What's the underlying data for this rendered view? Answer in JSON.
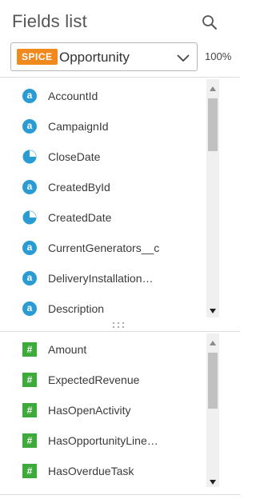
{
  "header": {
    "title": "Fields list",
    "search_icon": "search-icon"
  },
  "dataset": {
    "badge": "SPICE",
    "name": "Opportunity",
    "zoom": "100%"
  },
  "colors": {
    "dimension": "#2b9bd3",
    "measure": "#3eaa3b",
    "spice": "#f0891e"
  },
  "dimensions": [
    {
      "label": "AccountId",
      "icon": "a"
    },
    {
      "label": "CampaignId",
      "icon": "a"
    },
    {
      "label": "CloseDate",
      "icon": "clock"
    },
    {
      "label": "CreatedById",
      "icon": "a"
    },
    {
      "label": "CreatedDate",
      "icon": "clock"
    },
    {
      "label": "CurrentGenerators__c",
      "icon": "a"
    },
    {
      "label": "DeliveryInstallation…",
      "icon": "a"
    },
    {
      "label": "Description",
      "icon": "a"
    }
  ],
  "measures": [
    {
      "label": "Amount",
      "icon": "#"
    },
    {
      "label": "ExpectedRevenue",
      "icon": "#"
    },
    {
      "label": "HasOpenActivity",
      "icon": "#"
    },
    {
      "label": "HasOpportunityLine…",
      "icon": "#"
    },
    {
      "label": "HasOverdueTask",
      "icon": "#"
    }
  ]
}
